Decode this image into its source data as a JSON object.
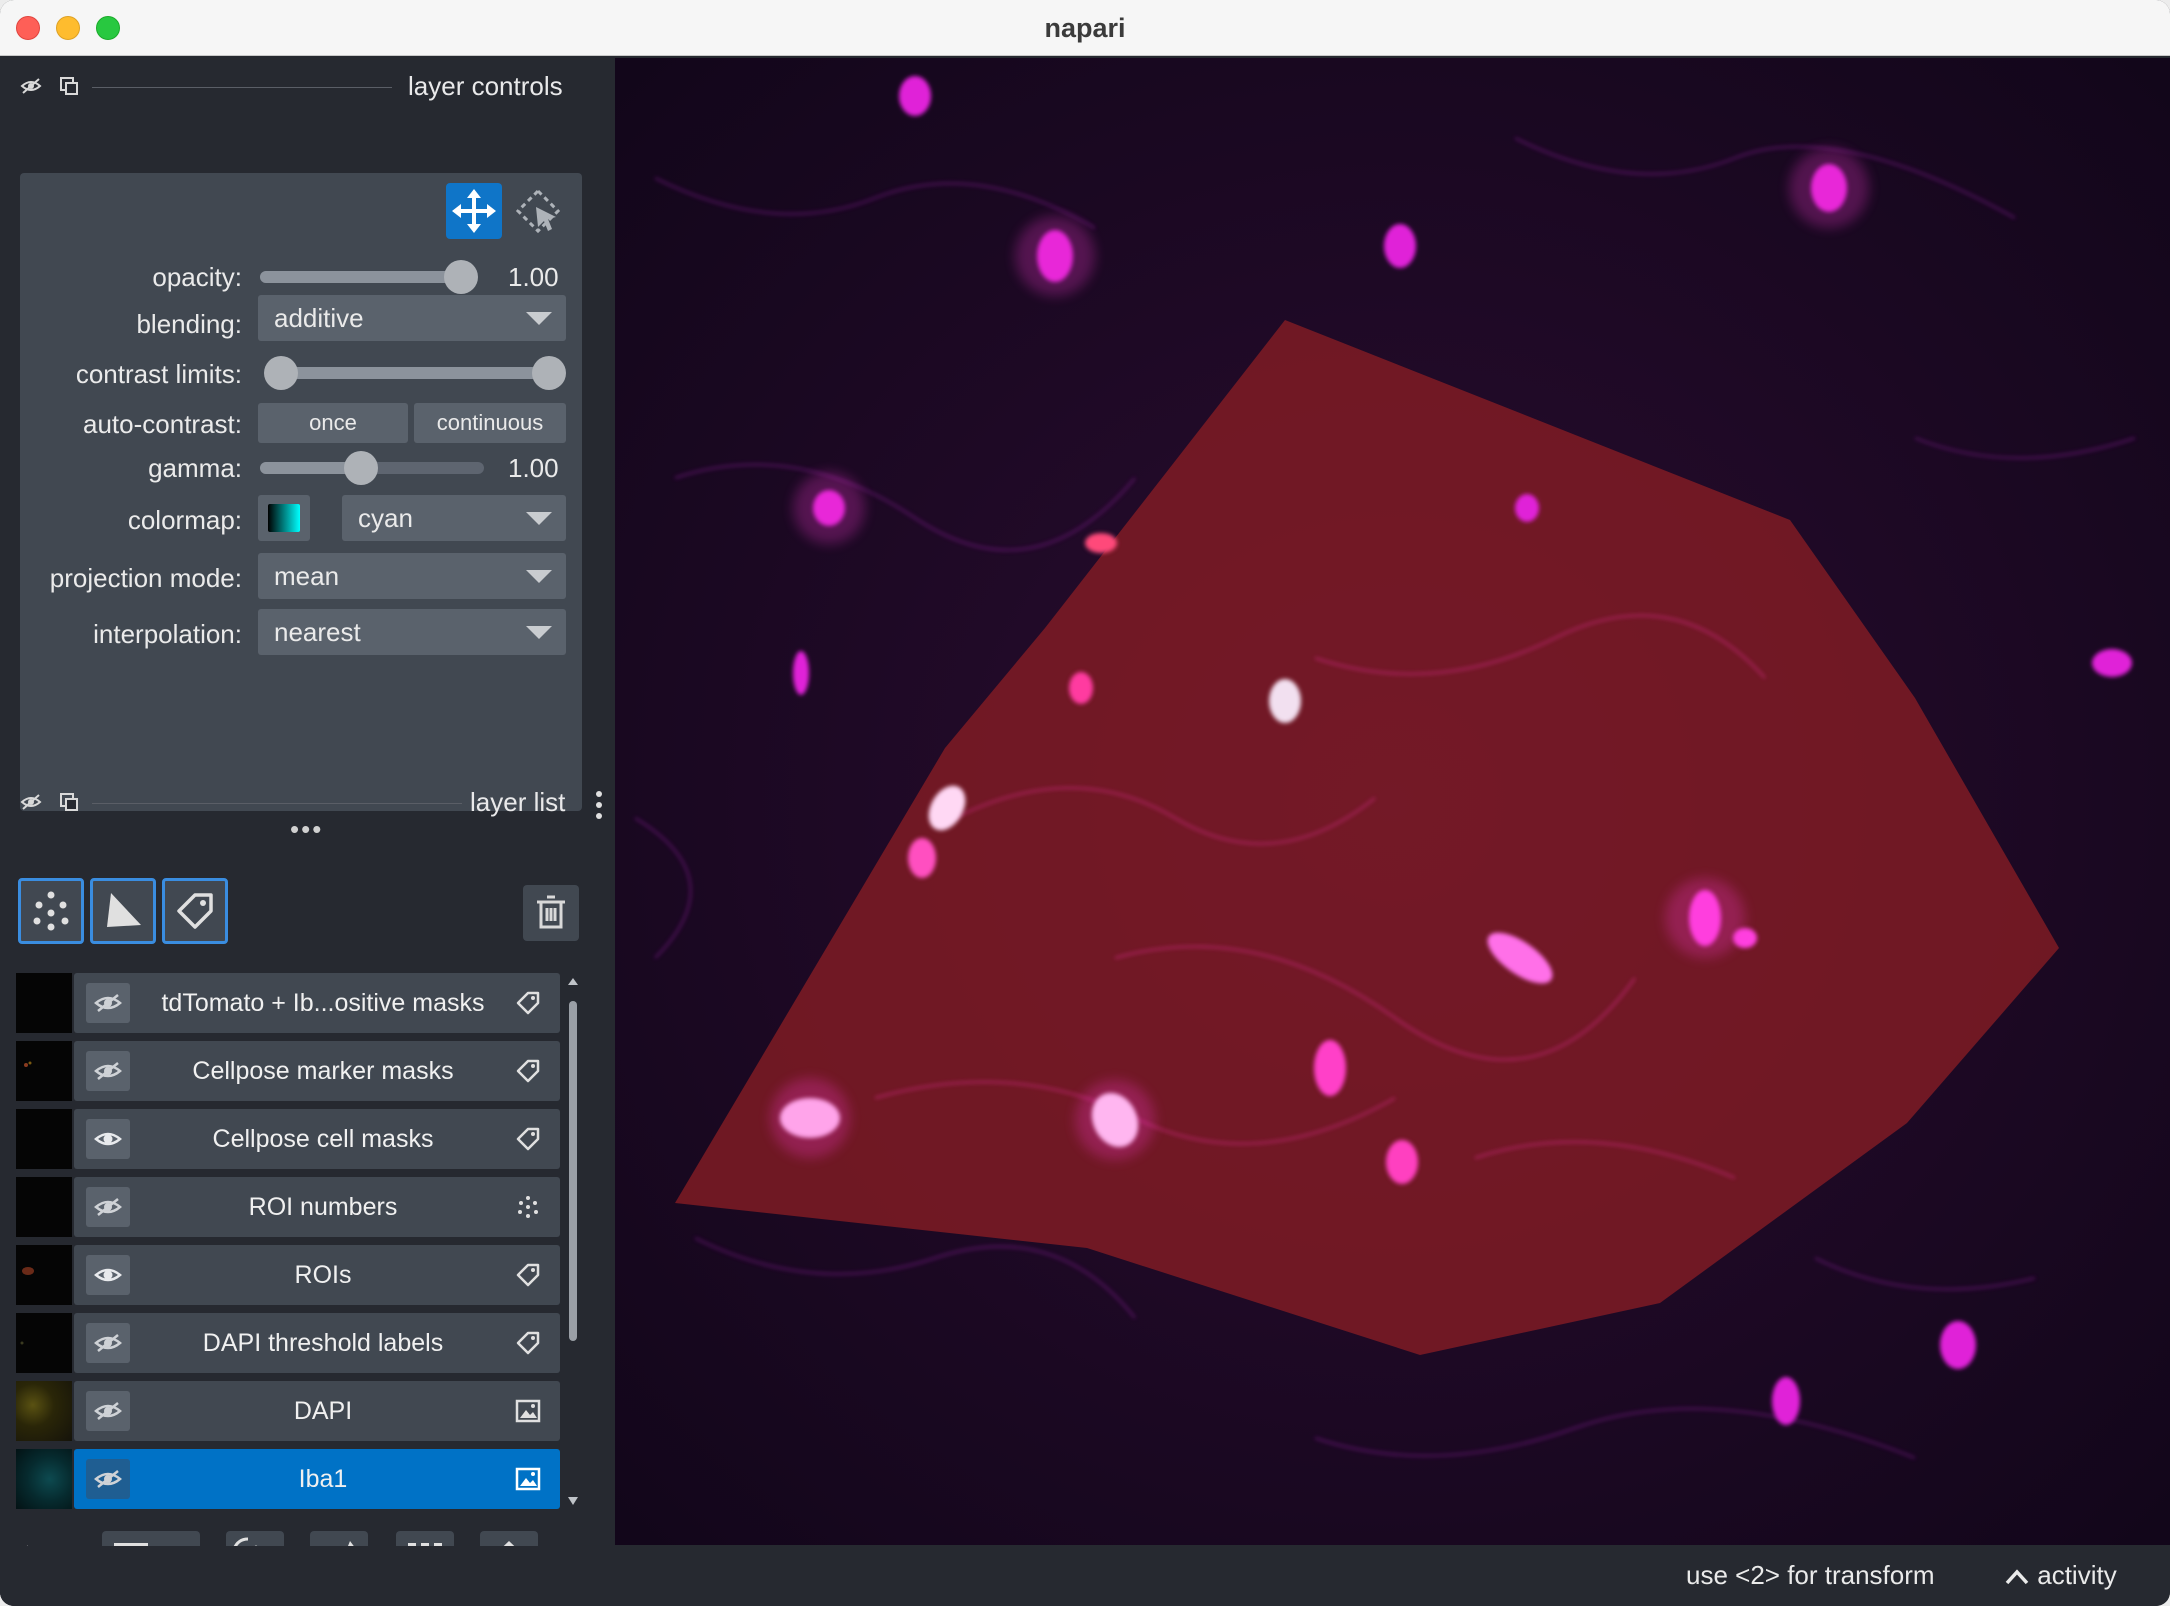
{
  "window": {
    "title": "napari"
  },
  "layer_controls": {
    "title": "layer controls",
    "opacity": {
      "label": "opacity:",
      "value": "1.00",
      "fraction": 1.0
    },
    "blending": {
      "label": "blending:",
      "value": "additive"
    },
    "contrast_limits": {
      "label": "contrast limits:",
      "low_fraction": 0.0,
      "high_fraction": 1.0
    },
    "auto_contrast": {
      "label": "auto-contrast:",
      "once": "once",
      "continuous": "continuous"
    },
    "gamma": {
      "label": "gamma:",
      "value": "1.00",
      "fraction": 0.45
    },
    "colormap": {
      "label": "colormap:",
      "value": "cyan"
    },
    "projection_mode": {
      "label": "projection mode:",
      "value": "mean"
    },
    "interpolation": {
      "label": "interpolation:",
      "value": "nearest"
    }
  },
  "layer_list": {
    "title": "layer list",
    "layers": [
      {
        "name": "tdTomato + Ib...ositive masks",
        "type": "labels",
        "visible": false
      },
      {
        "name": "Cellpose marker masks",
        "type": "labels",
        "visible": false
      },
      {
        "name": "Cellpose cell masks",
        "type": "labels",
        "visible": true
      },
      {
        "name": "ROI numbers",
        "type": "points",
        "visible": false
      },
      {
        "name": "ROIs",
        "type": "labels",
        "visible": true
      },
      {
        "name": "DAPI threshold labels",
        "type": "labels",
        "visible": false
      },
      {
        "name": "DAPI",
        "type": "image",
        "visible": false
      },
      {
        "name": "Iba1",
        "type": "image",
        "visible": false,
        "selected": true
      }
    ]
  },
  "status": {
    "hint": "use <2> for transform",
    "activity": "activity"
  },
  "colors": {
    "accent": "#0072c6",
    "panel": "#414851",
    "background": "#262930"
  }
}
